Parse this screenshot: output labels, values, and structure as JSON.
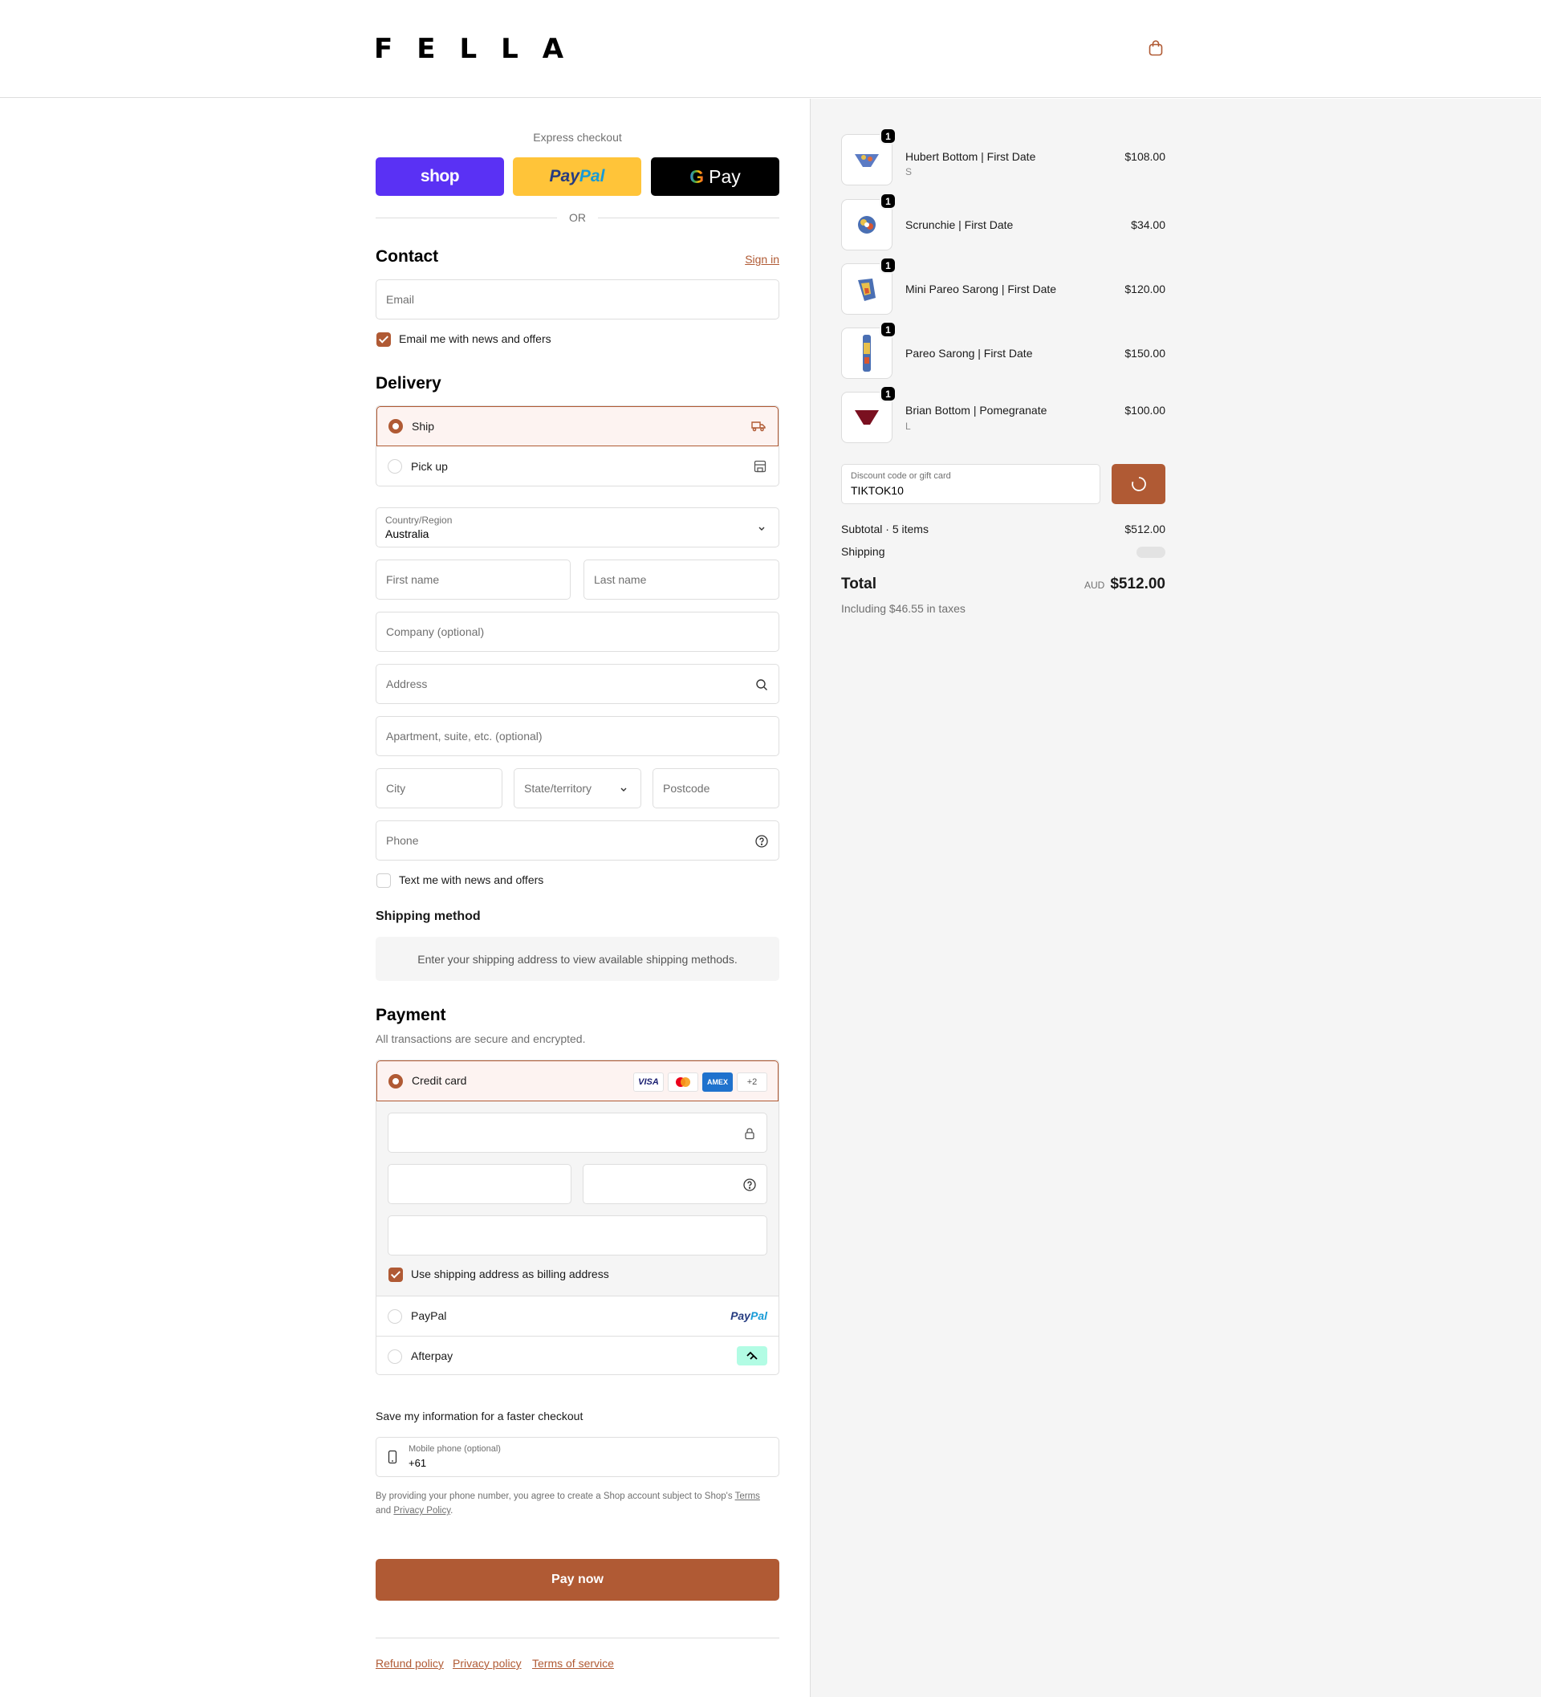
{
  "brand": {
    "logo": "FELLA",
    "accent": "#b05a34"
  },
  "header": {
    "cart_icon": "shopping-bag-icon"
  },
  "express": {
    "label": "Express checkout",
    "shop_label": "shop",
    "paypal_label_a": "Pay",
    "paypal_label_b": "Pal",
    "gpay_label": "Pay",
    "or_label": "OR"
  },
  "contact": {
    "title": "Contact",
    "sign_in": "Sign in",
    "email_placeholder": "Email",
    "news_label": "Email me with news and offers",
    "news_checked": true
  },
  "delivery": {
    "title": "Delivery",
    "options": [
      {
        "label": "Ship",
        "selected": true,
        "icon": "truck-icon"
      },
      {
        "label": "Pick up",
        "selected": false,
        "icon": "store-icon"
      }
    ],
    "country_label": "Country/Region",
    "country_value": "Australia",
    "first_name": "First name",
    "last_name": "Last name",
    "company": "Company (optional)",
    "address": "Address",
    "apartment": "Apartment, suite, etc. (optional)",
    "city": "City",
    "state": "State/territory",
    "postcode": "Postcode",
    "phone": "Phone",
    "sms_label": "Text me with news and offers",
    "sms_checked": false
  },
  "shipping_method": {
    "title": "Shipping method",
    "info": "Enter your shipping address to view available shipping methods."
  },
  "payment": {
    "title": "Payment",
    "subtitle": "All transactions are secure and encrypted.",
    "credit_card_label": "Credit card",
    "card_logos": [
      "VISA",
      "mastercard",
      "AMEX",
      "+2"
    ],
    "billing_label": "Use shipping address as billing address",
    "billing_checked": true,
    "paypal_label": "PayPal",
    "paypal_logo_a": "Pay",
    "paypal_logo_b": "Pal",
    "afterpay_label": "Afterpay"
  },
  "save_info": {
    "title": "Save my information for a faster checkout",
    "phone_label": "Mobile phone (optional)",
    "phone_value": "+61",
    "legal_prefix": "By providing your phone number, you agree to create a Shop account subject to Shop's",
    "terms": "Terms",
    "and": "and",
    "privacy": "Privacy Policy",
    "period": "."
  },
  "pay_now": "Pay now",
  "footer": {
    "links": [
      "Refund policy",
      "Privacy policy",
      "Terms of service"
    ]
  },
  "summary": {
    "items": [
      {
        "name": "Hubert Bottom | First Date",
        "variant": "S",
        "price": "$108.00",
        "qty": "1"
      },
      {
        "name": "Scrunchie | First Date",
        "variant": "",
        "price": "$34.00",
        "qty": "1"
      },
      {
        "name": "Mini Pareo Sarong | First Date",
        "variant": "",
        "price": "$120.00",
        "qty": "1"
      },
      {
        "name": "Pareo Sarong | First Date",
        "variant": "",
        "price": "$150.00",
        "qty": "1"
      },
      {
        "name": "Brian Bottom | Pomegranate",
        "variant": "L",
        "price": "$100.00",
        "qty": "1"
      }
    ],
    "discount_label": "Discount code or gift card",
    "discount_value": "TIKTOK10",
    "subtotal_label": "Subtotal · 5 items",
    "subtotal_value": "$512.00",
    "shipping_label": "Shipping",
    "total_label": "Total",
    "currency": "AUD",
    "total_value": "$512.00",
    "tax_note": "Including $46.55 in taxes"
  }
}
